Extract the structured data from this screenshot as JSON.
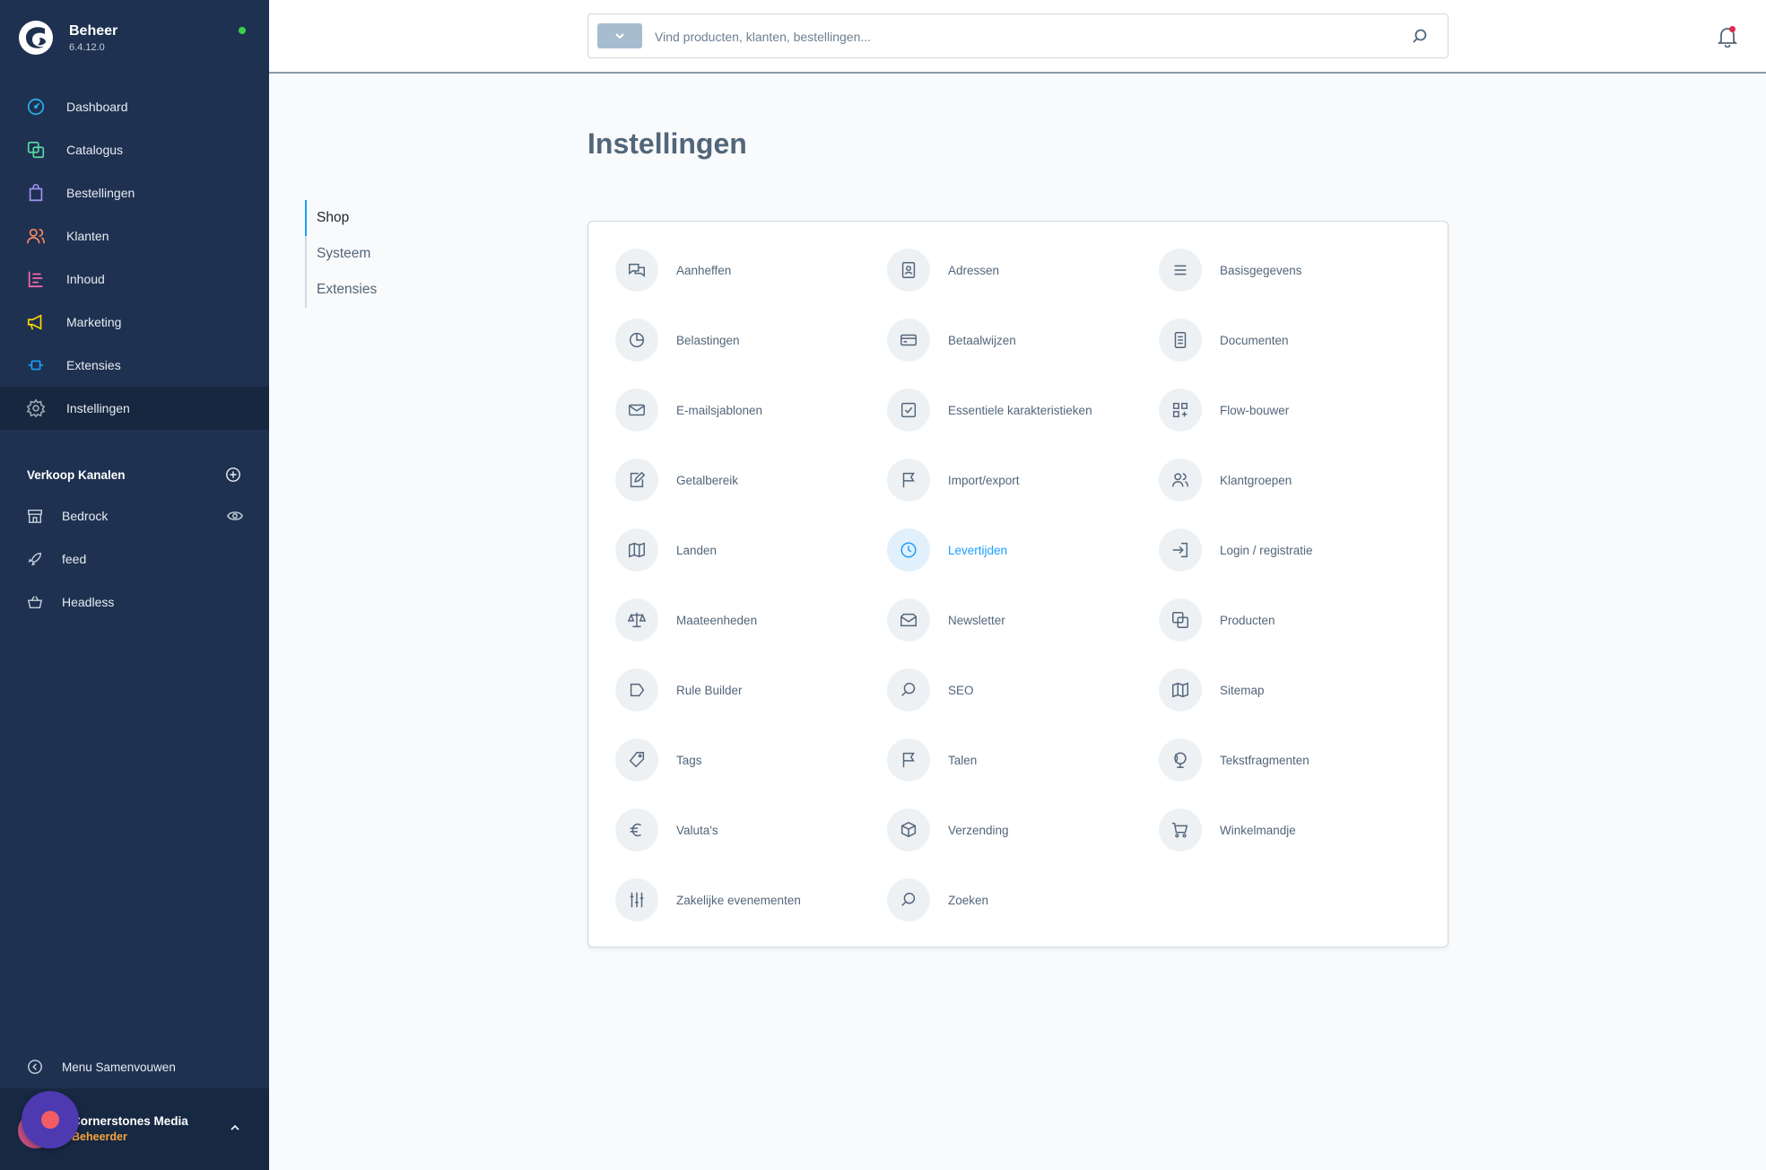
{
  "brand": {
    "title": "Beheer",
    "version": "6.4.12.0"
  },
  "nav": [
    {
      "label": "Dashboard",
      "icon": "dashboard-icon",
      "color": "#29b3f0"
    },
    {
      "label": "Catalogus",
      "icon": "catalog-icon",
      "color": "#57d9a3"
    },
    {
      "label": "Bestellingen",
      "icon": "orders-icon",
      "color": "#a092f0"
    },
    {
      "label": "Klanten",
      "icon": "customers-icon",
      "color": "#f88962"
    },
    {
      "label": "Inhoud",
      "icon": "content-icon",
      "color": "#ff68b4"
    },
    {
      "label": "Marketing",
      "icon": "marketing-icon",
      "color": "#ffd700"
    },
    {
      "label": "Extensies",
      "icon": "extensions-icon",
      "color": "#189eff"
    },
    {
      "label": "Instellingen",
      "icon": "settings-icon",
      "color": "#9aa8b5",
      "active": true
    }
  ],
  "sales_channels": {
    "title": "Verkoop Kanalen",
    "items": [
      {
        "label": "Bedrock",
        "icon": "storefront-icon"
      },
      {
        "label": "feed",
        "icon": "rocket-icon"
      },
      {
        "label": "Headless",
        "icon": "basket-icon"
      }
    ]
  },
  "collapse_label": "Menu Samenvouwen",
  "user": {
    "name": "Cornerstones Media",
    "role": "Beheerder"
  },
  "search": {
    "placeholder": "Vind producten, klanten, bestellingen..."
  },
  "page_title": "Instellingen",
  "tabs": [
    {
      "label": "Shop",
      "active": true
    },
    {
      "label": "Systeem"
    },
    {
      "label": "Extensies"
    }
  ],
  "settings": [
    {
      "label": "Aanheffen",
      "icon": "chat-icon"
    },
    {
      "label": "Adressen",
      "icon": "address-book-icon"
    },
    {
      "label": "Basisgegevens",
      "icon": "list-icon"
    },
    {
      "label": "Belastingen",
      "icon": "pie-chart-icon"
    },
    {
      "label": "Betaalwijzen",
      "icon": "credit-card-icon"
    },
    {
      "label": "Documenten",
      "icon": "document-icon"
    },
    {
      "label": "E-mailsjablonen",
      "icon": "envelope-icon"
    },
    {
      "label": "Essentiele karakteristieken",
      "icon": "checkbox-icon"
    },
    {
      "label": "Flow-bouwer",
      "icon": "flow-icon"
    },
    {
      "label": "Getalbereik",
      "icon": "edit-icon"
    },
    {
      "label": "Import/export",
      "icon": "flag-icon"
    },
    {
      "label": "Klantgroepen",
      "icon": "users-icon"
    },
    {
      "label": "Landen",
      "icon": "map-icon"
    },
    {
      "label": "Levertijden",
      "icon": "clock-icon",
      "highlight": true
    },
    {
      "label": "Login / registratie",
      "icon": "sign-in-icon"
    },
    {
      "label": "Maateenheden",
      "icon": "scale-icon"
    },
    {
      "label": "Newsletter",
      "icon": "inbox-icon"
    },
    {
      "label": "Producten",
      "icon": "products-icon"
    },
    {
      "label": "Rule Builder",
      "icon": "tag-shape-icon"
    },
    {
      "label": "SEO",
      "icon": "search-icon"
    },
    {
      "label": "Sitemap",
      "icon": "sitemap-icon"
    },
    {
      "label": "Tags",
      "icon": "tag-icon"
    },
    {
      "label": "Talen",
      "icon": "language-flag-icon"
    },
    {
      "label": "Tekstfragmenten",
      "icon": "globe-icon"
    },
    {
      "label": "Valuta's",
      "icon": "euro-icon"
    },
    {
      "label": "Verzending",
      "icon": "package-icon"
    },
    {
      "label": "Winkelmandje",
      "icon": "cart-icon"
    },
    {
      "label": "Zakelijke evenementen",
      "icon": "sliders-icon"
    },
    {
      "label": "Zoeken",
      "icon": "search-icon"
    }
  ],
  "colors": {
    "sidebar": "#1f3150",
    "accent": "#189eff",
    "online": "#37d046",
    "notification": "#de294c",
    "role": "#f7a33b"
  }
}
